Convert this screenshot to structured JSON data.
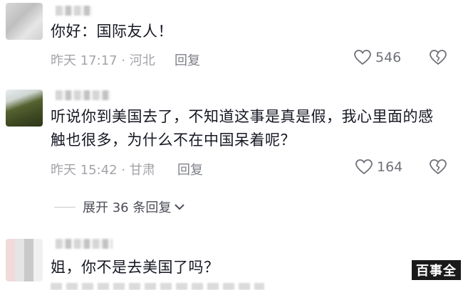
{
  "comments": [
    {
      "text": "你好：国际友人！",
      "meta": "昨天 17:17 · 河北",
      "reply_label": "回复",
      "likes": "546"
    },
    {
      "text": "听说你到美国去了，不知道这事是真是假，我心里面的感触也很多，为什么不在中国呆着呢？",
      "meta": "昨天 15:42 · 甘肃",
      "reply_label": "回复",
      "likes": "164",
      "expand_label": "展开 36 条回复"
    },
    {
      "text": "姐，你不是去美国了吗？"
    }
  ],
  "watermark": "百事全",
  "icons": {
    "like": "heart-outline-icon",
    "dislike": "broken-heart-icon",
    "expand": "chevron-down-icon"
  },
  "colors": {
    "text": "#161823",
    "meta": "#a3a4a9",
    "icon": "#6f7178"
  }
}
